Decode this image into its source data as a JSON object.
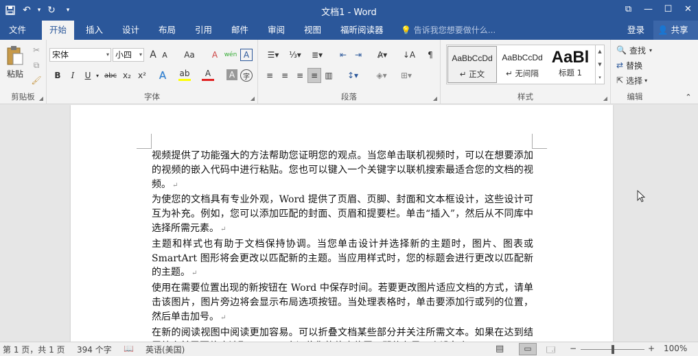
{
  "window": {
    "title": "文档1 - Word"
  },
  "qat": {
    "save": "💾",
    "undo": "↶",
    "undo_arrow": "▾",
    "redo": "↻",
    "customize": "▾"
  },
  "window_controls": {
    "ribbon_options": "⧉",
    "minimize": "—",
    "restore": "☐",
    "close": "✕"
  },
  "tabs": [
    {
      "label": "文件"
    },
    {
      "label": "开始"
    },
    {
      "label": "插入"
    },
    {
      "label": "设计"
    },
    {
      "label": "布局"
    },
    {
      "label": "引用"
    },
    {
      "label": "邮件"
    },
    {
      "label": "审阅"
    },
    {
      "label": "视图"
    },
    {
      "label": "福昕阅读器"
    }
  ],
  "tell_me": {
    "placeholder": "告诉我您想要做什么..."
  },
  "account": {
    "signin": "登录",
    "share": "共享"
  },
  "ribbon": {
    "clipboard": {
      "paste": "粘贴",
      "label": "剪贴板"
    },
    "font": {
      "name": "宋体",
      "size": "小四",
      "label": "字体",
      "bold": "B",
      "italic": "I",
      "underline": "U",
      "strike": "abc",
      "sub": "x₂",
      "sup": "x²",
      "grow": "A",
      "shrink": "A",
      "case": "Aa",
      "clear": "A",
      "pinyin": "wén",
      "border_char": "A",
      "shade_char": "A",
      "enclose": "字"
    },
    "paragraph": {
      "label": "段落"
    },
    "styles": {
      "label": "样式",
      "items": [
        {
          "sample": "AaBbCcDd",
          "name": "↵ 正文"
        },
        {
          "sample": "AaBbCcDd",
          "name": "↵ 无间隔"
        },
        {
          "sample": "AaBl",
          "name": "标题 1"
        }
      ]
    },
    "editing": {
      "find": "查找",
      "replace": "替换",
      "select": "选择",
      "label": "编辑"
    }
  },
  "document": {
    "paragraphs": [
      "视频提供了功能强大的方法帮助您证明您的观点。当您单击联机视频时，可以在想要添加的视频的嵌入代码中进行粘贴。您也可以键入一个关键字以联机搜索最适合您的文档的视频。",
      "为使您的文档具有专业外观，Word 提供了页眉、页脚、封面和文本框设计，这些设计可互为补充。例如，您可以添加匹配的封面、页眉和提要栏。单击“插入”，然后从不同库中选择所需元素。",
      "主题和样式也有助于文档保持协调。当您单击设计并选择新的主题时，图片、图表或 SmartArt 图形将会更改以匹配新的主题。当应用样式时，您的标题会进行更改以匹配新的主题。",
      "使用在需要位置出现的新按钮在 Word 中保存时间。若要更改图片适应文档的方式，请单击该图片，图片旁边将会显示布局选项按钮。当处理表格时，单击要添加行或列的位置，然后单击加号。",
      "在新的阅读视图中阅读更加容易。可以折叠文档某些部分并关注所需文本。如果在达到结尾处之前需要停止读取，Word 会记住您的停止位置 - 即使在另一个设备上。"
    ],
    "para_mark": "↵"
  },
  "status": {
    "page": "第 1 页，共 1 页",
    "words": "394 个字",
    "language": "英语(美国)",
    "zoom": "100%",
    "zoom_level": 1.0
  }
}
